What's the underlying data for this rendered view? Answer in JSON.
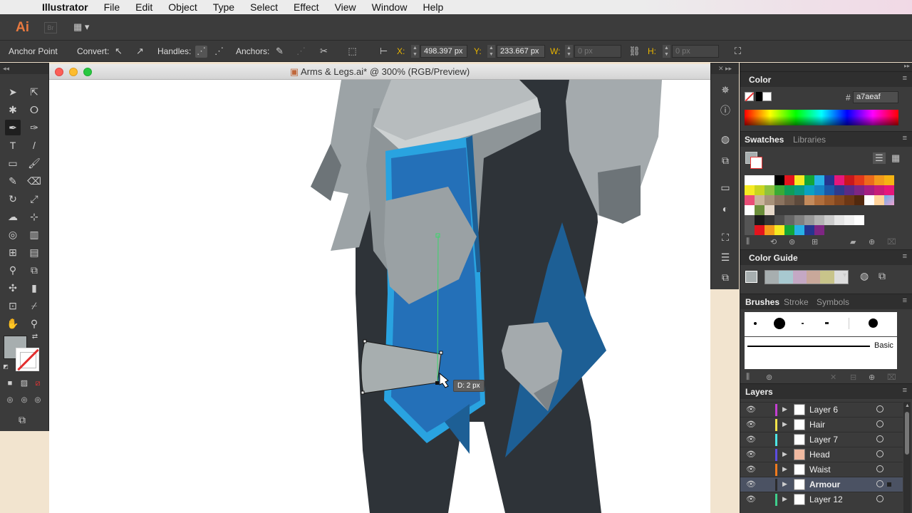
{
  "menubar": {
    "app": "Illustrator",
    "items": [
      "File",
      "Edit",
      "Object",
      "Type",
      "Select",
      "Effect",
      "View",
      "Window",
      "Help"
    ]
  },
  "appbar": {
    "logo": "Ai",
    "bridge": "Br",
    "workspace_icon": "workspace-switcher-icon"
  },
  "controlbar": {
    "tool_name": "Anchor Point",
    "convert_label": "Convert:",
    "handles_label": "Handles:",
    "anchors_label": "Anchors:",
    "x_label": "X:",
    "x_value": "498.397 px",
    "y_label": "Y:",
    "y_value": "233.667 px",
    "w_label": "W:",
    "w_value": "0 px",
    "h_label": "H:",
    "h_value": "0 px"
  },
  "document": {
    "title": "Arms & Legs.ai* @ 300% (RGB/Preview)",
    "tooltip": "D: 2 px"
  },
  "colors": {
    "fill": "#a7aeaf",
    "armour_blue": "#2470b8",
    "armour_trim": "#29a3e0",
    "metal": "#a4aaad",
    "body": "#2e3338"
  },
  "panels": {
    "color": {
      "title": "Color",
      "hash": "#",
      "hex": "a7aeaf"
    },
    "swatches": {
      "tabs": [
        "Swatches",
        "Libraries"
      ]
    },
    "color_guide": {
      "title": "Color Guide"
    },
    "brushes": {
      "tabs": [
        "Brushes",
        "Stroke",
        "Symbols"
      ],
      "basic_label": "Basic"
    },
    "layers": {
      "title": "Layers",
      "items": [
        {
          "name": "Layer 6",
          "color": "#c43fd1"
        },
        {
          "name": "Hair",
          "color": "#f2e34a"
        },
        {
          "name": "Layer 7",
          "color": "#4ee6e6"
        },
        {
          "name": "Head",
          "color": "#5c4de0"
        },
        {
          "name": "Waist",
          "color": "#f07a1d"
        },
        {
          "name": "Armour",
          "color": "#2c2c2c"
        },
        {
          "name": "Layer 12",
          "color": "#3fcf8c"
        }
      ]
    }
  }
}
